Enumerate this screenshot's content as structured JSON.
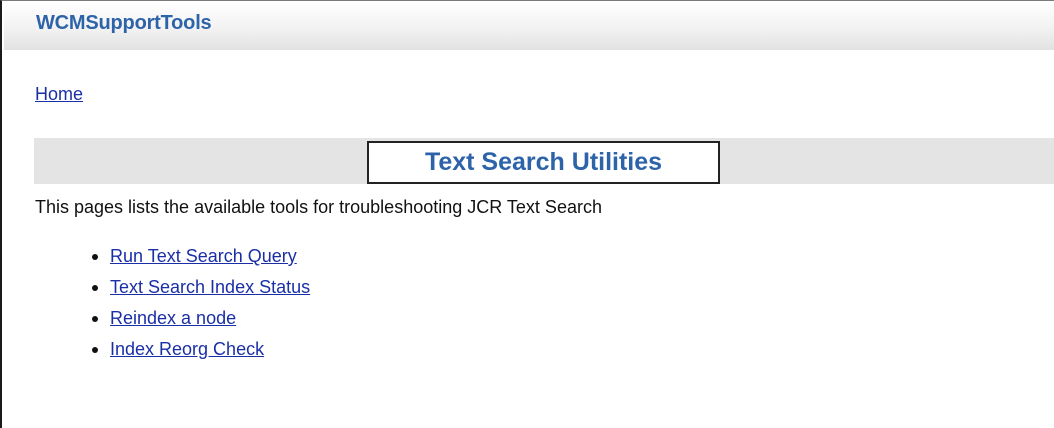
{
  "header": {
    "app_title": "WCMSupportTools"
  },
  "breadcrumb": {
    "home_label": "Home"
  },
  "main": {
    "title": "Text Search Utilities",
    "description": "This pages lists the available tools for troubleshooting JCR Text Search",
    "tools": [
      {
        "label": "Run Text Search Query"
      },
      {
        "label": "Text Search Index Status"
      },
      {
        "label": "Reindex a node"
      },
      {
        "label": "Index Reorg Check"
      }
    ]
  },
  "colors": {
    "accent": "#2d63a8",
    "link": "#1a2fa6",
    "title_band": "#e4e4e4"
  }
}
